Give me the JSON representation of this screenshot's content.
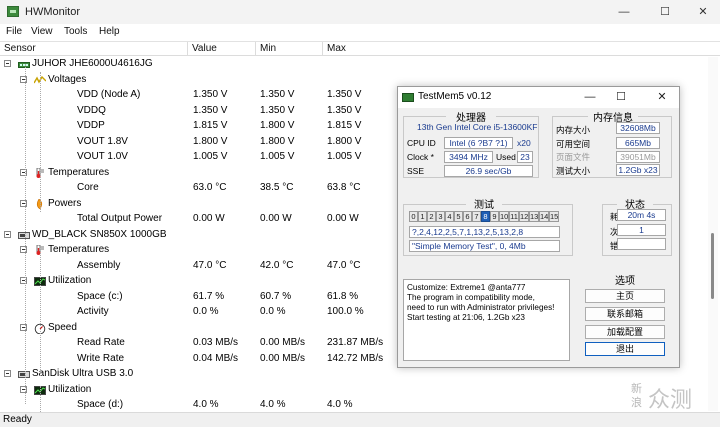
{
  "window": {
    "title": "HWMonitor",
    "minimize": "—",
    "maximize": "☐",
    "close": "✕"
  },
  "menu": [
    "File",
    "View",
    "Tools",
    "Help"
  ],
  "columns": [
    "Sensor",
    "Value",
    "Min",
    "Max"
  ],
  "tree": [
    {
      "label": "JUHOR JHE6000U4616JG",
      "level": 1,
      "icon": "memory-icon"
    },
    {
      "label": "Voltages",
      "level": 2,
      "icon": "voltage-icon"
    },
    {
      "label": "VDD (Node A)",
      "level": 3,
      "value": "1.350 V",
      "min": "1.350 V",
      "max": "1.350 V"
    },
    {
      "label": "VDDQ",
      "level": 3,
      "value": "1.350 V",
      "min": "1.350 V",
      "max": "1.350 V"
    },
    {
      "label": "VDDP",
      "level": 3,
      "value": "1.815 V",
      "min": "1.800 V",
      "max": "1.815 V"
    },
    {
      "label": "VOUT 1.8V",
      "level": 3,
      "value": "1.800 V",
      "min": "1.800 V",
      "max": "1.800 V"
    },
    {
      "label": "VOUT 1.0V",
      "level": 3,
      "value": "1.005 V",
      "min": "1.005 V",
      "max": "1.005 V"
    },
    {
      "label": "Temperatures",
      "level": 2,
      "icon": "thermometer-icon"
    },
    {
      "label": "Core",
      "level": 3,
      "value": "63.0 °C",
      "min": "38.5 °C",
      "max": "63.8 °C"
    },
    {
      "label": "Powers",
      "level": 2,
      "icon": "power-icon"
    },
    {
      "label": "Total Output Power",
      "level": 3,
      "value": "0.00 W",
      "min": "0.00 W",
      "max": "0.00 W"
    },
    {
      "label": "WD_BLACK SN850X 1000GB",
      "level": 1,
      "icon": "drive-icon"
    },
    {
      "label": "Temperatures",
      "level": 2,
      "icon": "thermometer-icon"
    },
    {
      "label": "Assembly",
      "level": 3,
      "value": "47.0 °C",
      "min": "42.0 °C",
      "max": "47.0 °C"
    },
    {
      "label": "Utilization",
      "level": 2,
      "icon": "utilization-icon"
    },
    {
      "label": "Space (c:)",
      "level": 3,
      "value": "61.7 %",
      "min": "60.7 %",
      "max": "61.8 %"
    },
    {
      "label": "Activity",
      "level": 3,
      "value": "0.0 %",
      "min": "0.0 %",
      "max": "100.0 %"
    },
    {
      "label": "Speed",
      "level": 2,
      "icon": "speed-icon"
    },
    {
      "label": "Read Rate",
      "level": 3,
      "value": "0.03 MB/s",
      "min": "0.00 MB/s",
      "max": "231.87 MB/s"
    },
    {
      "label": "Write Rate",
      "level": 3,
      "value": "0.04 MB/s",
      "min": "0.00 MB/s",
      "max": "142.72 MB/s"
    },
    {
      "label": "SanDisk Ultra USB 3.0",
      "level": 1,
      "icon": "drive-icon"
    },
    {
      "label": "Utilization",
      "level": 2,
      "icon": "utilization-icon"
    },
    {
      "label": "Space (d:)",
      "level": 3,
      "value": "4.0 %",
      "min": "4.0 %",
      "max": "4.0 %"
    }
  ],
  "status": "Ready",
  "testmem": {
    "title": "TestMem5 v0.12",
    "processor": {
      "heading": "处理器",
      "cpu_name": "13th Gen Intel Core i5-13600KF",
      "cpu_id_label": "CPU ID",
      "cpu_id": "Intel (6 ?B7 ?1)",
      "cpu_x": "x20",
      "clock_label": "Clock *",
      "clock": "3494 MHz",
      "used_label": "Used",
      "used": "23",
      "sse_label": "SSE",
      "sse": "26.9 sec/Gb"
    },
    "memory": {
      "heading": "内存信息",
      "total_label": "内存大小",
      "total": "32608Mb",
      "avail_label": "可用空间",
      "avail": "665Mb",
      "page_label": "页面文件",
      "page": "39051Mb",
      "test_label": "测试大小",
      "test": "1.2Gb x23"
    },
    "test": {
      "heading": "测试",
      "cells": [
        "0",
        "1",
        "2",
        "3",
        "4",
        "5",
        "6",
        "7",
        "8",
        "9",
        "10",
        "11",
        "12",
        "13",
        "14",
        "15"
      ],
      "active_cell": 8,
      "sequence": "?,2,4,12,2,5,7,1,13,2,5,13,2,8",
      "current": "\"Simple Memory Test\", 0, 4Mb"
    },
    "status": {
      "heading": "状态",
      "time_label": "耗 时",
      "time": "20m 4s",
      "count_label": "次 数",
      "count": "1",
      "errors_label": "错 误",
      "errors": ""
    },
    "log": [
      "Customize: Extreme1 @anta777",
      "The program in compatibility mode,",
      "need to run with Administrator privileges!",
      "Start testing at 21:06, 1.2Gb x23"
    ],
    "options": {
      "heading": "选项",
      "home": "主页",
      "mail": "联系邮箱",
      "load": "加载配置",
      "exit": "退出"
    }
  },
  "watermark": {
    "line1": "新",
    "line2": "浪",
    "text": "众测"
  }
}
